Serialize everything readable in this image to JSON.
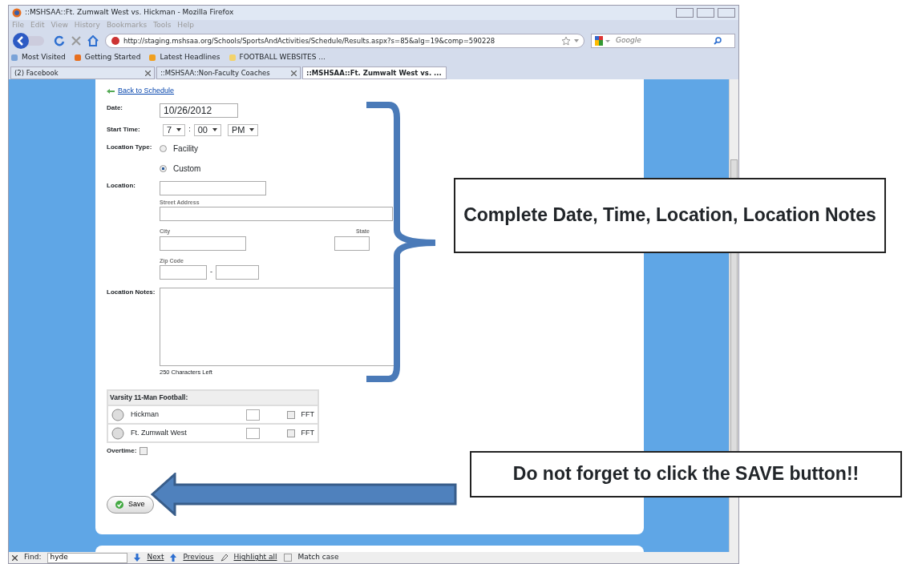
{
  "window": {
    "title": "::MSHSAA::Ft. Zumwalt West vs. Hickman - Mozilla Firefox"
  },
  "menu": [
    "File",
    "Edit",
    "View",
    "History",
    "Bookmarks",
    "Tools",
    "Help"
  ],
  "address_bar": {
    "url": "http://staging.mshsaa.org/Schools/SportsAndActivities/Schedule/Results.aspx?s=85&alg=19&comp=590228"
  },
  "search": {
    "placeholder": "Google"
  },
  "bookmarks": [
    "Most Visited",
    "Getting Started",
    "Latest Headlines",
    "FOOTBALL WEBSITES ..."
  ],
  "tabs": [
    {
      "label": "(2) Facebook",
      "selected": false
    },
    {
      "label": "::MSHSAA::Non-Faculty Coaches",
      "selected": false
    },
    {
      "label": "::MSHSAA::Ft. Zumwalt West vs. ...",
      "selected": true
    }
  ],
  "form": {
    "back_link": "Back to Schedule",
    "date": {
      "label": "Date:",
      "value": "10/26/2012"
    },
    "start_time": {
      "label": "Start Time:",
      "hour": "7",
      "separator": ":",
      "minute": "00",
      "period": "PM"
    },
    "location_type": {
      "label": "Location Type:",
      "options": [
        {
          "label": "Facility",
          "selected": false
        },
        {
          "label": "Custom",
          "selected": true
        }
      ]
    },
    "location": {
      "label": "Location:",
      "street_label": "Street Address",
      "city_label": "City",
      "state_label": "State",
      "zip_label": "Zip Code",
      "zip_separator": "-"
    },
    "location_notes": {
      "label": "Location Notes:",
      "counter": "250 Characters Left"
    },
    "teams": {
      "title": "Varsity 11-Man Football:",
      "rows": [
        {
          "name": "Hickman",
          "fft_label": "FFT",
          "fft_checked": false
        },
        {
          "name": "Ft. Zumwalt West",
          "fft_label": "FFT",
          "fft_checked": false
        }
      ]
    },
    "overtime": {
      "label": "Overtime:",
      "checked": false
    },
    "save_button": "Save"
  },
  "find_bar": {
    "label": "Find:",
    "value": "hyde",
    "next": "Next",
    "previous": "Previous",
    "highlight": "Highlight all",
    "match_case": {
      "label": "Match case",
      "checked": false
    }
  },
  "annotations": [
    "Complete Date, Time, Location, Location Notes",
    "Do not forget to click the SAVE button!!"
  ]
}
